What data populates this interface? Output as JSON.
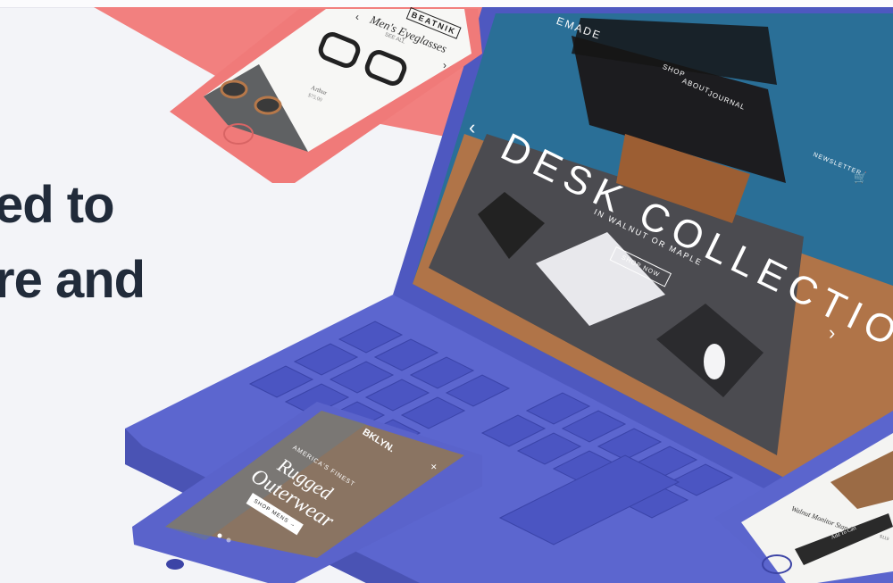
{
  "headline": {
    "line1": "ed to",
    "line2": "re and"
  },
  "laptop_site": {
    "brand_fragment": "EMADE",
    "nav": [
      "SHOP",
      "ABOUT",
      "JOURNAL"
    ],
    "newsletter": "NEWSLETTER",
    "hero_title": "DESK COLLECTION",
    "hero_subtitle": "IN WALNUT OR MAPLE",
    "cta": "SHOP NOW",
    "prev_arrow": "‹",
    "next_arrow": "›"
  },
  "phone_top": {
    "brand": "BEATNIK",
    "product_title": "Men's Eyeglasses",
    "product_count": "SEE ALL",
    "item_name": "Arthur",
    "item_price": "$75.00",
    "nav_prev": "‹",
    "nav_next": "›"
  },
  "phone_bottom": {
    "brand": "BKLYN.",
    "kicker": "AMERICA'S FINEST",
    "title_line1": "Rugged",
    "title_line2": "Outerwear",
    "cta": "SHOP MENS →"
  },
  "phone_right": {
    "product_name": "Walnut Monitor Stand",
    "product_price": "$119",
    "cta": "Add To Cart"
  },
  "colors": {
    "indigo": "#5861c9",
    "coral": "#f2807f",
    "headline": "#212b3a",
    "page_bg": "#f3f4f8"
  }
}
